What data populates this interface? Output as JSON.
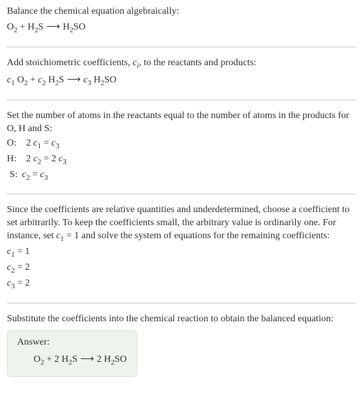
{
  "section1": {
    "intro": "Balance the chemical equation algebraically:",
    "eq_lhs1": "O",
    "eq_lhs1_sub": "2",
    "eq_plus1": " + H",
    "eq_lhs2_sub": "2",
    "eq_lhs2_tail": "S",
    "arrow": "⟶",
    "eq_rhs1": "H",
    "eq_rhs1_sub": "2",
    "eq_rhs1_tail": "SO"
  },
  "section2": {
    "intro_a": "Add stoichiometric coefficients, ",
    "ci": "c",
    "ci_sub": "i",
    "intro_b": ", to the reactants and products:",
    "c1": "c",
    "c1_sub": "1",
    "sp1": " O",
    "o2_sub": "2",
    "plus1": " + ",
    "c2": "c",
    "c2_sub": "2",
    "sp2": " H",
    "h2_sub": "2",
    "sp2_tail": "S",
    "arrow": "⟶",
    "c3": "c",
    "c3_sub": "3",
    "sp3": " H",
    "h2so_sub": "2",
    "sp3_tail": "SO"
  },
  "section3": {
    "intro": "Set the number of atoms in the reactants equal to the number of atoms in the products for O, H and S:",
    "o_label": "O:",
    "o_lhs_coef": "2 ",
    "o_c1": "c",
    "o_c1_sub": "1",
    "o_eq": " = ",
    "o_c3": "c",
    "o_c3_sub": "3",
    "h_label": "H:",
    "h_lhs_coef": "2 ",
    "h_c2": "c",
    "h_c2_sub": "2",
    "h_eq": " = 2 ",
    "h_c3": "c",
    "h_c3_sub": "3",
    "s_label": "S:",
    "s_c2": "c",
    "s_c2_sub": "2",
    "s_eq": " = ",
    "s_c3": "c",
    "s_c3_sub": "3"
  },
  "section4": {
    "intro_a": "Since the coefficients are relative quantities and underdetermined, choose a coefficient to set arbitrarily. To keep the coefficients small, the arbitrary value is ordinarily one. For instance, set ",
    "c1": "c",
    "c1_sub": "1",
    "intro_b": " = 1 and solve the system of equations for the remaining coefficients:",
    "l1_c": "c",
    "l1_sub": "1",
    "l1_val": " = 1",
    "l2_c": "c",
    "l2_sub": "2",
    "l2_val": " = 2",
    "l3_c": "c",
    "l3_sub": "3",
    "l3_val": " = 2"
  },
  "section5": {
    "intro": "Substitute the coefficients into the chemical reaction to obtain the balanced equation:",
    "answer_label": "Answer:",
    "eq_o": "O",
    "eq_o_sub": "2",
    "eq_plus": " + 2 H",
    "eq_h2s_sub": "2",
    "eq_h2s_tail": "S",
    "arrow": "⟶",
    "eq_rhs_coef": "2 H",
    "eq_rhs_sub": "2",
    "eq_rhs_tail": "SO"
  }
}
